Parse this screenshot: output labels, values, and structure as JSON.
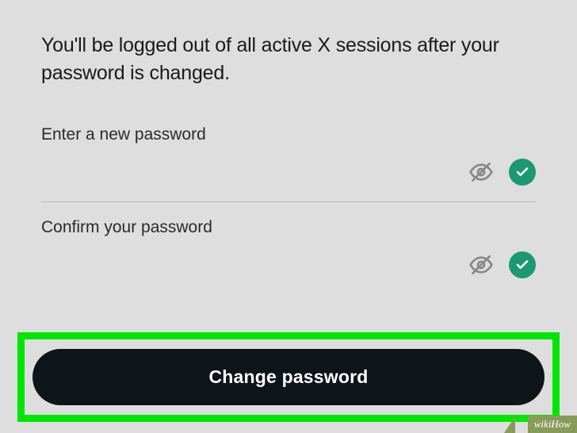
{
  "info": {
    "text": "You'll be logged out of all active X sessions after your password is changed."
  },
  "fields": {
    "new_password": {
      "label": "Enter a new password"
    },
    "confirm_password": {
      "label": "Confirm your password"
    }
  },
  "button": {
    "label": "Change password"
  },
  "watermark": {
    "text": "wikiHow"
  }
}
